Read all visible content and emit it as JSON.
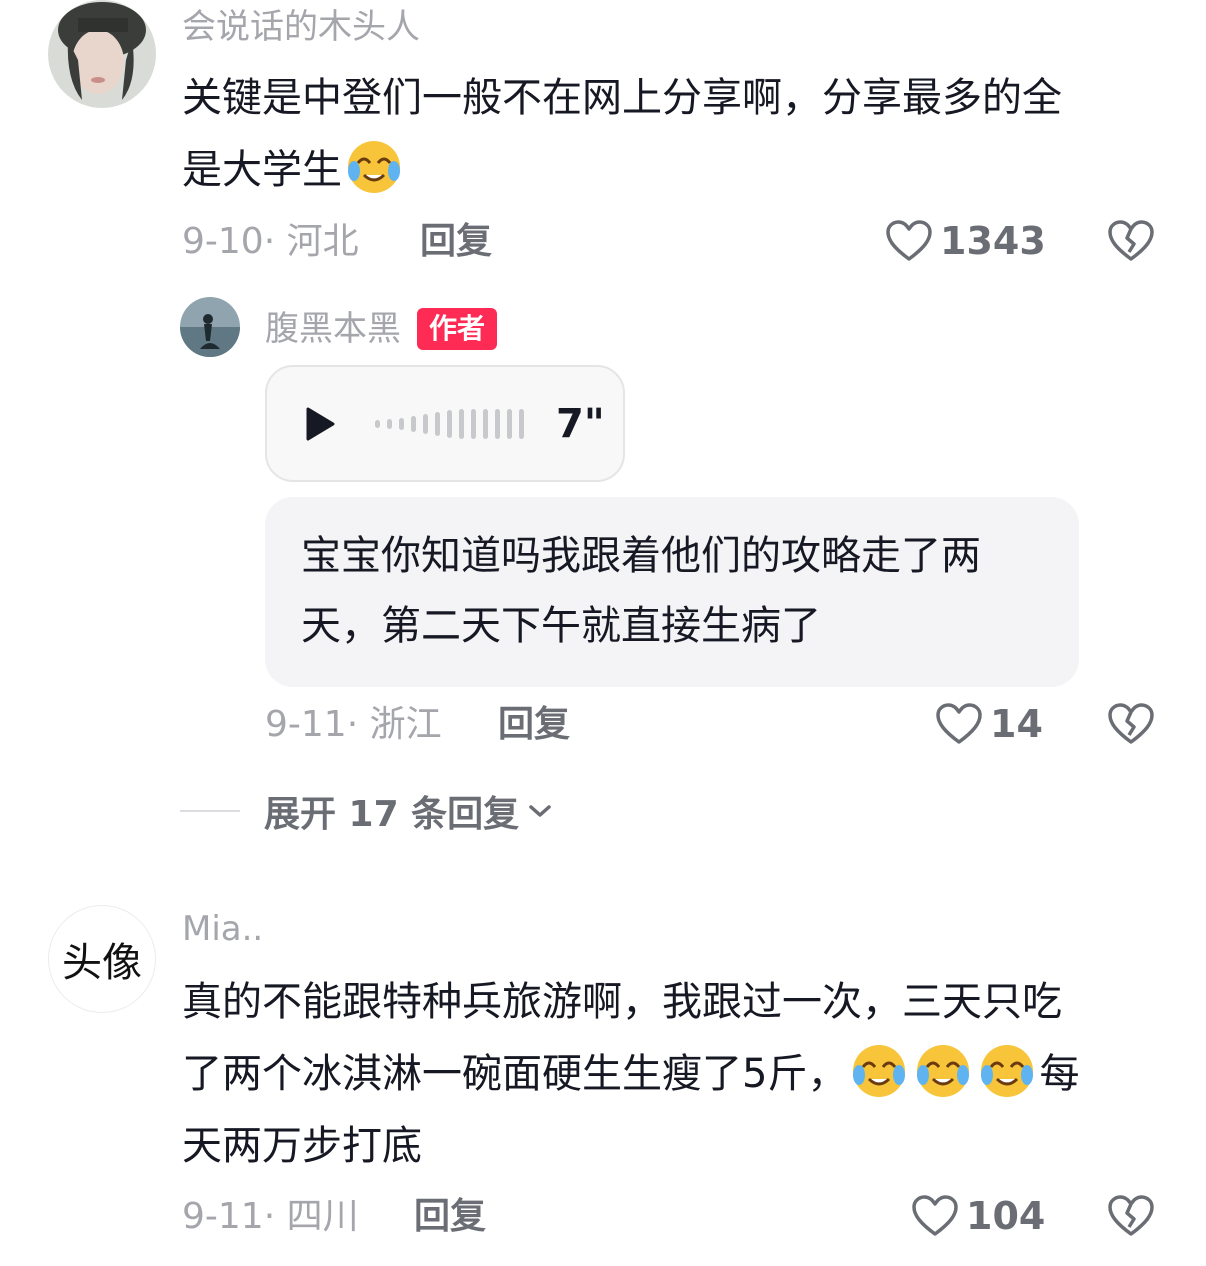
{
  "comments": [
    {
      "username": "会说话的木头人",
      "text_line1": "关键是中登们一般不在网上分享啊，分享最多的全",
      "text_line2": "是大学生",
      "emoji": "crying-laugh-emoji",
      "date_location": "9-10· 河北",
      "reply_label": "回复",
      "likes": "1343"
    },
    {
      "username": "Mia..",
      "avatar_text": "头像",
      "text_line1": "真的不能跟特种兵旅游啊，我跟过一次，三天只吃",
      "text_line2": "了两个冰淇淋一碗面硬生生瘦了5斤，",
      "text_line2_tail": "每",
      "text_line3": "天两万步打底",
      "date_location": "9-11· 四川",
      "reply_label": "回复",
      "likes": "104"
    }
  ],
  "author_reply": {
    "username": "腹黑本黑",
    "badge": "作者",
    "voice_duration": "7\"",
    "text_line1": "宝宝你知道吗我跟着他们的攻略走了两",
    "text_line2": "天，第二天下午就直接生病了",
    "date_location": "9-11· 浙江",
    "reply_label": "回复",
    "likes": "14"
  },
  "expand_replies": {
    "label": "展开 17 条回复"
  },
  "colors": {
    "author_badge": "#fe2c55",
    "meta_gray": "#a4a6ab",
    "bubble_bg": "#f4f4f6"
  }
}
